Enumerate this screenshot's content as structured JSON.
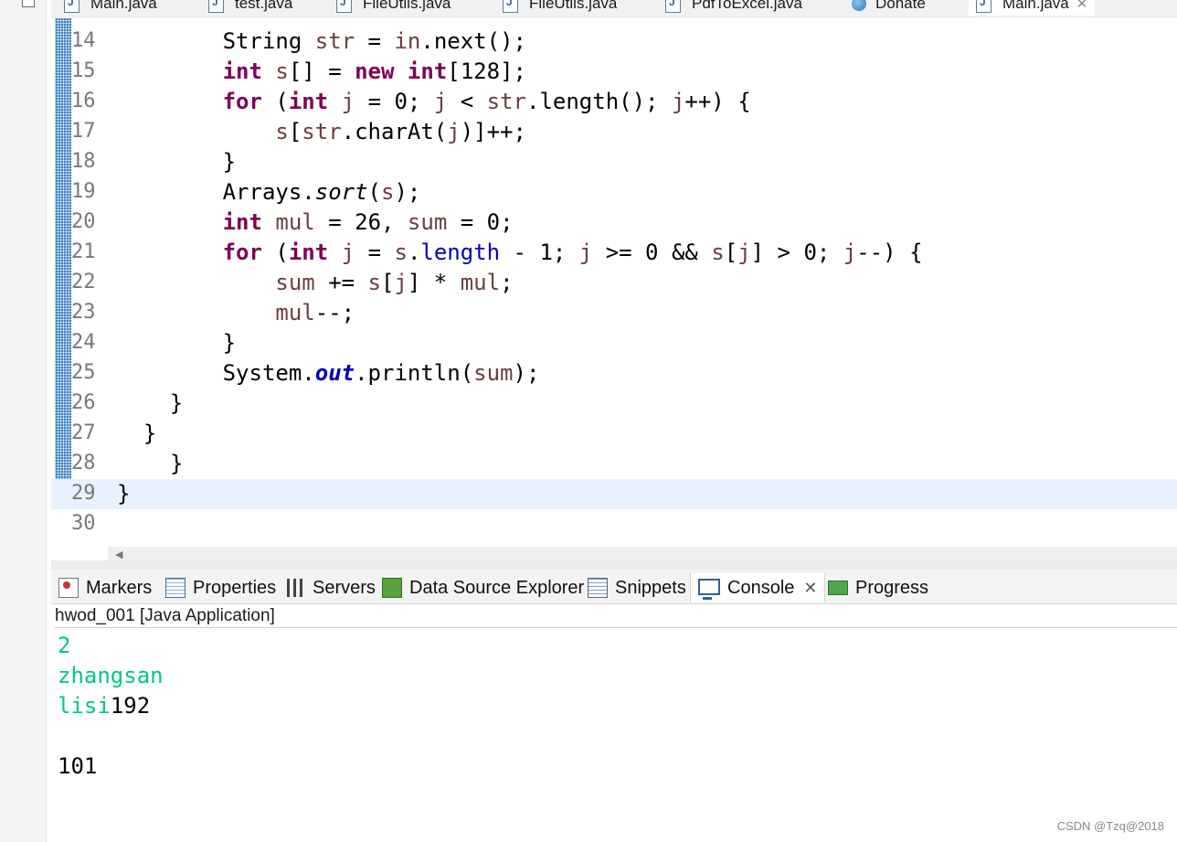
{
  "editor_tabs": [
    {
      "label": "Main.java",
      "icon": "java-file-icon"
    },
    {
      "label": "test.java",
      "icon": "java-file-icon"
    },
    {
      "label": "FileUtils.java",
      "icon": "java-file-icon"
    },
    {
      "label": "FileUtils.java",
      "icon": "java-file-icon"
    },
    {
      "label": "PdfToExcel.java",
      "icon": "java-file-icon"
    },
    {
      "label": "Donate",
      "icon": "globe-icon"
    },
    {
      "label": "Main.java",
      "icon": "java-file-warning-icon",
      "active": true
    }
  ],
  "code": {
    "lines": [
      {
        "num": "14"
      },
      {
        "num": "15"
      },
      {
        "num": "16"
      },
      {
        "num": "17"
      },
      {
        "num": "18"
      },
      {
        "num": "19"
      },
      {
        "num": "20"
      },
      {
        "num": "21"
      },
      {
        "num": "22"
      },
      {
        "num": "23"
      },
      {
        "num": "24"
      },
      {
        "num": "25"
      },
      {
        "num": "26"
      },
      {
        "num": "27"
      },
      {
        "num": "28"
      },
      {
        "num": "29"
      },
      {
        "num": "30"
      }
    ],
    "current_line": "29"
  },
  "view_tabs": [
    {
      "label": "Markers",
      "icon": "markers-icon"
    },
    {
      "label": "Properties",
      "icon": "properties-icon"
    },
    {
      "label": "Servers",
      "icon": "servers-icon"
    },
    {
      "label": "Data Source Explorer",
      "icon": "data-source-explorer-icon"
    },
    {
      "label": "Snippets",
      "icon": "snippets-icon"
    },
    {
      "label": "Console",
      "icon": "console-icon",
      "active": true
    },
    {
      "label": "Progress",
      "icon": "progress-icon"
    }
  ],
  "console": {
    "title": "hwod_001 [Java Application]",
    "output": [
      {
        "input": "2",
        "output": ""
      },
      {
        "input": "zhangsan",
        "output": ""
      },
      {
        "input": "lisi",
        "output": "192"
      },
      {
        "input": "",
        "output": ""
      },
      {
        "input": "",
        "output": "101"
      }
    ]
  },
  "watermark": "CSDN @Tzq@2018",
  "colors": {
    "keyword": "#7f0055",
    "local_variable": "#6a3e3e",
    "field": "#0000c0",
    "console_input": "#00c87e",
    "current_line": "#e8f2fe"
  }
}
